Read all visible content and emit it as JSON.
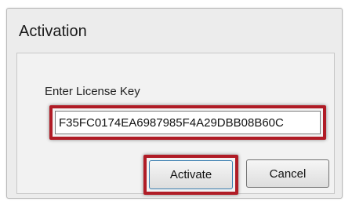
{
  "dialog": {
    "title": "Activation"
  },
  "form": {
    "license_label": "Enter License Key",
    "license_value": "F35FC0174EA6987985F4A29DBB08B60C"
  },
  "buttons": {
    "activate_label": "Activate",
    "cancel_label": "Cancel"
  },
  "colors": {
    "highlight": "#b01c26"
  }
}
